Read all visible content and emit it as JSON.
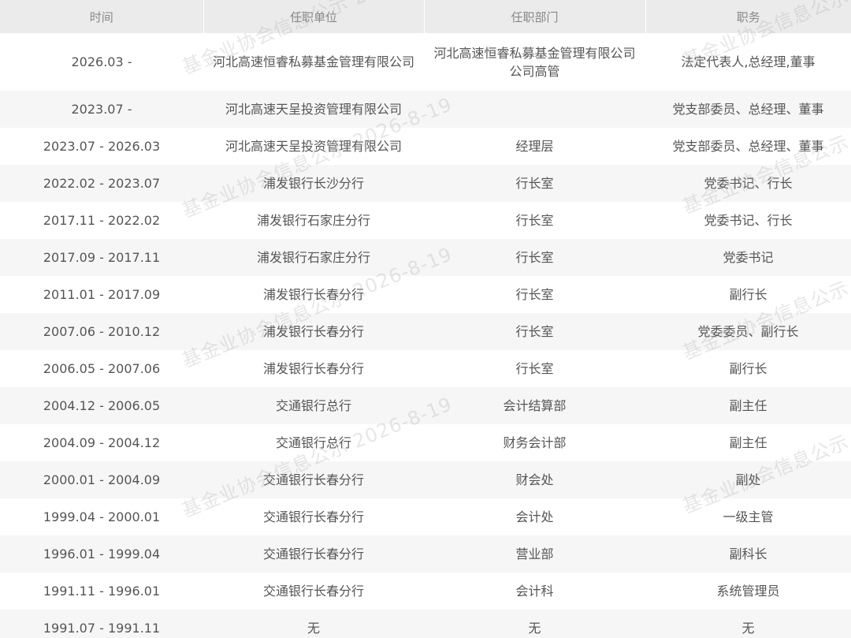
{
  "table": {
    "headers": [
      "时间",
      "任职单位",
      "任职部门",
      "职务"
    ],
    "rows": [
      [
        "2026.03 -",
        "河北高速恒睿私募基金管理有限公司",
        "河北高速恒睿私募基金管理有限公司公司高管",
        "法定代表人,总经理,董事"
      ],
      [
        "2023.07 -",
        "河北高速天呈投资管理有限公司",
        "",
        "党支部委员、总经理、董事"
      ],
      [
        "2023.07 - 2026.03",
        "河北高速天呈投资管理有限公司",
        "经理层",
        "党支部委员、总经理、董事"
      ],
      [
        "2022.02 - 2023.07",
        "浦发银行长沙分行",
        "行长室",
        "党委书记、行长"
      ],
      [
        "2017.11 - 2022.02",
        "浦发银行石家庄分行",
        "行长室",
        "党委书记、行长"
      ],
      [
        "2017.09 - 2017.11",
        "浦发银行石家庄分行",
        "行长室",
        "党委书记"
      ],
      [
        "2011.01 - 2017.09",
        "浦发银行长春分行",
        "行长室",
        "副行长"
      ],
      [
        "2007.06 - 2010.12",
        "浦发银行长春分行",
        "行长室",
        "党委委员、副行长"
      ],
      [
        "2006.05 - 2007.06",
        "浦发银行长春分行",
        "行长室",
        "副行长"
      ],
      [
        "2004.12 - 2006.05",
        "交通银行总行",
        "会计结算部",
        "副主任"
      ],
      [
        "2004.09 - 2004.12",
        "交通银行总行",
        "财务会计部",
        "副主任"
      ],
      [
        "2000.01 - 2004.09",
        "交通银行长春分行",
        "财会处",
        "副处"
      ],
      [
        "1999.04 - 2000.01",
        "交通银行长春分行",
        "会计处",
        "一级主管"
      ],
      [
        "1996.01 - 1999.04",
        "交通银行长春分行",
        "营业部",
        "副科长"
      ],
      [
        "1991.11 - 1996.01",
        "交通银行长春分行",
        "会计科",
        "系统管理员"
      ],
      [
        "1991.07 - 1991.11",
        "无",
        "无",
        "无"
      ]
    ]
  },
  "watermark": {
    "text": "基金业协会信息公示 2026-8-19"
  }
}
